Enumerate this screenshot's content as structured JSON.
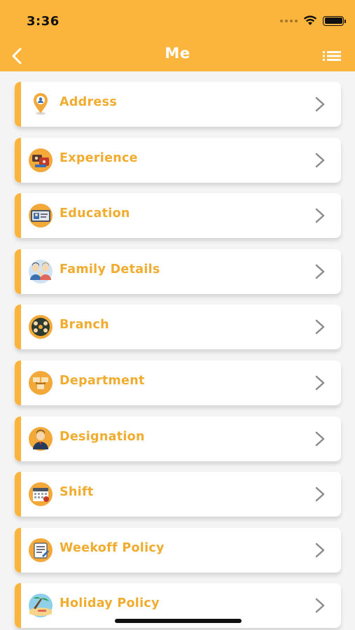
{
  "status_bar": {
    "time": "3:36"
  },
  "nav": {
    "title": "Me"
  },
  "menu_items": [
    {
      "label": "Address",
      "icon": "location-pin-icon"
    },
    {
      "label": "Experience",
      "icon": "experience-icon"
    },
    {
      "label": "Education",
      "icon": "education-id-card-icon"
    },
    {
      "label": "Family Details",
      "icon": "family-icon"
    },
    {
      "label": "Branch",
      "icon": "branch-network-icon"
    },
    {
      "label": "Department",
      "icon": "department-icon"
    },
    {
      "label": "Designation",
      "icon": "designation-person-icon"
    },
    {
      "label": "Shift",
      "icon": "calendar-shift-icon"
    },
    {
      "label": "Weekoff Policy",
      "icon": "weekoff-policy-icon"
    },
    {
      "label": "Holiday Policy",
      "icon": "holiday-policy-icon"
    }
  ],
  "colors": {
    "accent": "#fbb53d",
    "label": "#f1ac2f",
    "chevron": "#8c8c8c",
    "background": "#f4f4f4"
  }
}
